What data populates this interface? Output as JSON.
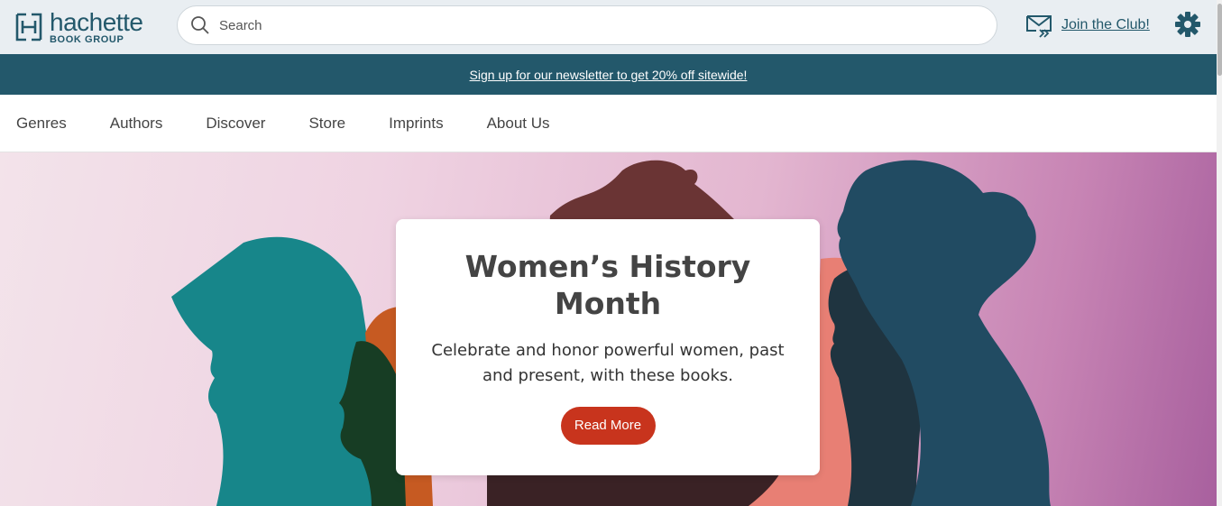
{
  "brand": {
    "name": "hachette",
    "subtitle": "BOOK GROUP"
  },
  "search": {
    "placeholder": "Search",
    "value": ""
  },
  "header": {
    "club_link": "Join the Club!"
  },
  "promo": {
    "text": "Sign up for our newsletter to get 20% off sitewide!"
  },
  "nav": {
    "items": [
      "Genres",
      "Authors",
      "Discover",
      "Store",
      "Imprints",
      "About Us"
    ]
  },
  "hero": {
    "title": "Women’s History Month",
    "text": "Celebrate and honor powerful women, past and present, with these books.",
    "button": "Read More"
  },
  "icons": {
    "search": "search-icon",
    "mail": "mail-icon",
    "settings": "gear-icon",
    "logo": "logo-mark"
  },
  "colors": {
    "brand": "#23586b",
    "button": "#c8341d",
    "topbar": "#e9eef2"
  }
}
